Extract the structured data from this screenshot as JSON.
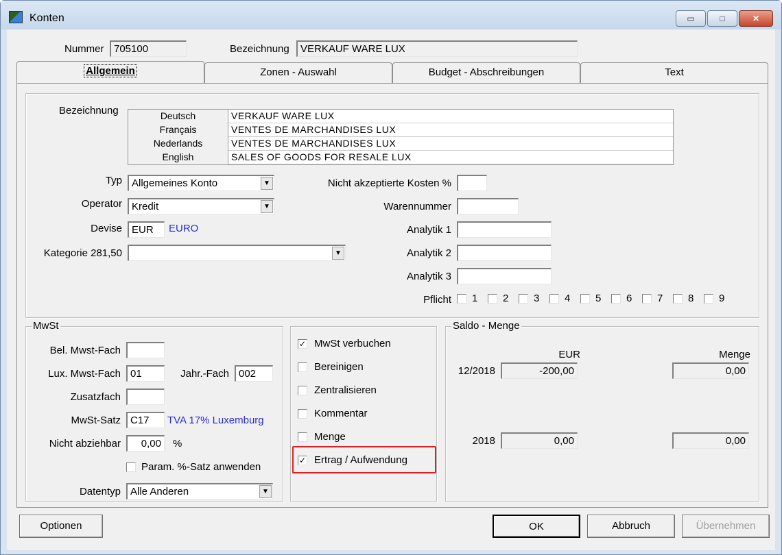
{
  "window": {
    "title": "Konten",
    "minimize_label": "▭",
    "maximize_label": "□",
    "close_label": "✕"
  },
  "header": {
    "nummer_label": "Nummer",
    "nummer_value": "705100",
    "bezeichnung_label": "Bezeichnung",
    "bezeichnung_value": "VERKAUF WARE LUX"
  },
  "tabs": [
    {
      "label": "Allgemein"
    },
    {
      "label": "Zonen - Auswahl"
    },
    {
      "label": "Budget - Abschreibungen"
    },
    {
      "label": "Text"
    }
  ],
  "general": {
    "bezeichnung_label": "Bezeichnung",
    "languages": [
      {
        "lang": "Deutsch",
        "value": "VERKAUF WARE LUX"
      },
      {
        "lang": "Français",
        "value": "VENTES DE MARCHANDISES LUX"
      },
      {
        "lang": "Nederlands",
        "value": "VENTES DE MARCHANDISES LUX"
      },
      {
        "lang": "English",
        "value": "SALES OF GOODS FOR RESALE LUX"
      }
    ],
    "typ_label": "Typ",
    "typ_value": "Allgemeines Konto",
    "operator_label": "Operator",
    "operator_value": "Kredit",
    "devise_label": "Devise",
    "devise_value": "EUR",
    "devise_name": "EURO",
    "kategorie_label": "Kategorie 281,50",
    "kategorie_value": "",
    "nicht_akz_label": "Nicht akzeptierte Kosten  %",
    "nicht_akz_value": "",
    "warennummer_label": "Warennummer",
    "warennummer_value": "",
    "analytik1_label": "Analytik 1",
    "analytik1_value": "",
    "analytik2_label": "Analytik 2",
    "analytik2_value": "",
    "analytik3_label": "Analytik 3",
    "analytik3_value": "",
    "pflicht_label": "Pflicht",
    "pflicht_items": [
      "1",
      "2",
      "3",
      "4",
      "5",
      "6",
      "7",
      "8",
      "9"
    ]
  },
  "mwst": {
    "title": "MwSt",
    "bel_label": "Bel. Mwst-Fach",
    "bel_value": "",
    "lux_label": "Lux. Mwst-Fach",
    "lux_value": "01",
    "jahr_label": "Jahr.-Fach",
    "jahr_value": "002",
    "zusatz_label": "Zusatzfach",
    "zusatz_value": "",
    "satz_label": "MwSt-Satz",
    "satz_value": "C17",
    "satz_name": "TVA 17% Luxemburg",
    "nicht_abz_label": "Nicht abziehbar",
    "nicht_abz_value": "0,00",
    "nicht_abz_unit": "%",
    "param_label": "Param. %-Satz anwenden",
    "param_checked": false,
    "datentyp_label": "Datentyp",
    "datentyp_value": "Alle Anderen"
  },
  "options": [
    {
      "label": "MwSt verbuchen",
      "checked": true,
      "mark": "✓"
    },
    {
      "label": "Bereinigen",
      "checked": false,
      "mark": ""
    },
    {
      "label": "Zentralisieren",
      "checked": false,
      "mark": ""
    },
    {
      "label": "Kommentar",
      "checked": false,
      "mark": ""
    },
    {
      "label": "Menge",
      "checked": false,
      "mark": ""
    },
    {
      "label": "Ertrag / Aufwendung",
      "checked": true,
      "mark": "✓"
    }
  ],
  "saldo": {
    "title": "Saldo - Menge",
    "eur_header": "EUR",
    "menge_header": "Menge",
    "row1_label": "12/2018",
    "row1_eur": "-200,00",
    "row1_menge": "0,00",
    "row2_label": "2018",
    "row2_eur": "0,00",
    "row2_menge": "0,00"
  },
  "buttons": {
    "optionen": "Optionen",
    "ok": "OK",
    "abbruch": "Abbruch",
    "uebernehmen": "Übernehmen"
  },
  "colors": {
    "highlight": "#e02020",
    "link": "#2b2bd6"
  }
}
